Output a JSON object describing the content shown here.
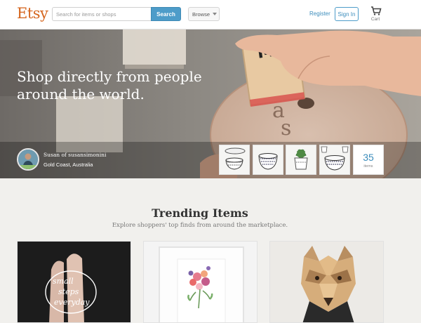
{
  "header": {
    "logo": "Etsy",
    "search_placeholder": "Search for items or shops",
    "search_button": "Search",
    "browse_button": "Browse",
    "register_link": "Register",
    "signin_button": "Sign In",
    "cart_label": "Cart"
  },
  "hero": {
    "title": "Shop directly from people around the world.",
    "shop_name": "Susan of susansimonini",
    "shop_location": "Gold Coast, Australia",
    "items_count": "35",
    "items_label": "items"
  },
  "trending": {
    "title": "Trending Items",
    "subtitle": "Explore shoppers' top finds from around the marketplace.",
    "card1_handwriting": [
      "small",
      "steps",
      "everyday"
    ]
  },
  "colors": {
    "brand": "#d5641c",
    "accent": "#4d9cc9",
    "link": "#3c8dbc",
    "trending_bg": "#f1f0ed"
  }
}
